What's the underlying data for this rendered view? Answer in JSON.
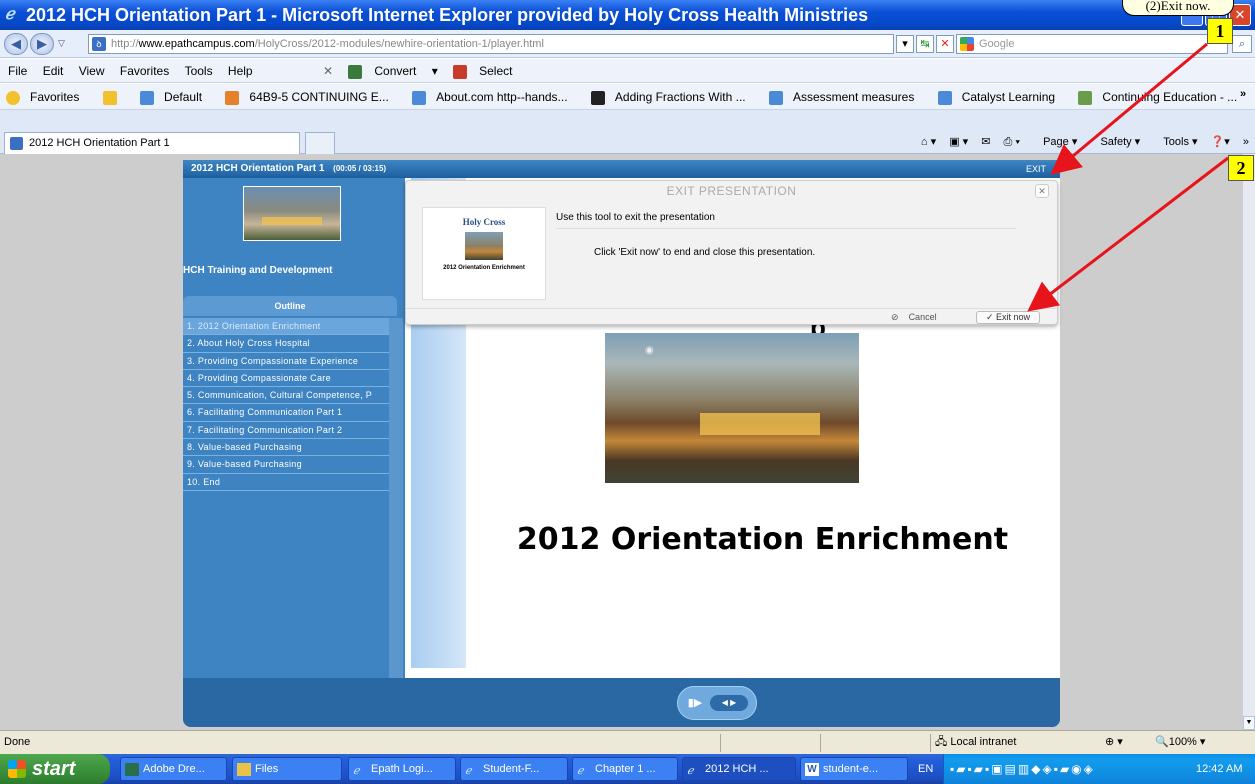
{
  "window": {
    "title": "2012 HCH Orientation Part 1 - Microsoft Internet Explorer provided by Holy Cross Health Ministries"
  },
  "address": {
    "url_prefix": "http://",
    "url_domain": "www.epathcampus.com",
    "url_path": "/HolyCross/2012-modules/newhire-orientation-1/player.html",
    "search_placeholder": "Google"
  },
  "menu": [
    "File",
    "Edit",
    "View",
    "Favorites",
    "Tools",
    "Help"
  ],
  "menu_extra": {
    "convert": "Convert",
    "select": "Select"
  },
  "favorites": {
    "label": "Favorites",
    "items": [
      "Default",
      "64B9-5 CONTINUING E...",
      "About.com http--hands...",
      "Adding Fractions With ...",
      "Assessment measures",
      "Catalyst Learning",
      "Continuing Education - ..."
    ]
  },
  "tab": {
    "label": "2012 HCH Orientation Part 1"
  },
  "commands": {
    "page": "Page",
    "safety": "Safety",
    "tools": "Tools"
  },
  "player": {
    "title": "2012 HCH Orientation Part 1",
    "time": "(00:05 / 03:15)",
    "exit": "EXIT",
    "org": "HCH Training and Development",
    "outline_label": "Outline",
    "outline": [
      "1. 2012 Orientation Enrichment",
      "2. About Holy Cross Hospital",
      "3. Providing Compassionate Experience",
      "4. Providing Compassionate Care",
      "5. Communication, Cultural Competence, P",
      "6. Facilitating Communication Part 1",
      "7. Facilitating Communication Part 2",
      "8. Value-based Purchasing",
      "9. Value-based Purchasing",
      "10. End"
    ],
    "slide_title": "2012 Orientation Enrichment",
    "slide_top_char": "p"
  },
  "dialog": {
    "title": "EXIT PRESENTATION",
    "line1": "Use this tool to exit the presentation",
    "line2": "Click 'Exit now' to end and close this presentation.",
    "thumb_logo": "Holy Cross",
    "thumb_caption": "2012 Orientation Enrichment",
    "cancel": "Cancel",
    "exit_now": "Exit now"
  },
  "annotation": {
    "callout": "(2)Exit now.",
    "badge1": "1",
    "badge2": "2"
  },
  "status": {
    "left": "Done",
    "zone": "Local intranet",
    "zoom": "100%"
  },
  "taskbar": {
    "start": "start",
    "tasks": [
      "Adobe Dre...",
      "Files",
      "Epath Logi...",
      "Student-F...",
      "Chapter 1 ...",
      "2012 HCH ...",
      "student-e..."
    ],
    "lang": "EN",
    "clock": "12:42 AM"
  },
  "colors": {
    "arrow": "#e8141c",
    "player_blue": "#2f6ea8",
    "badge": "#ffff00"
  }
}
